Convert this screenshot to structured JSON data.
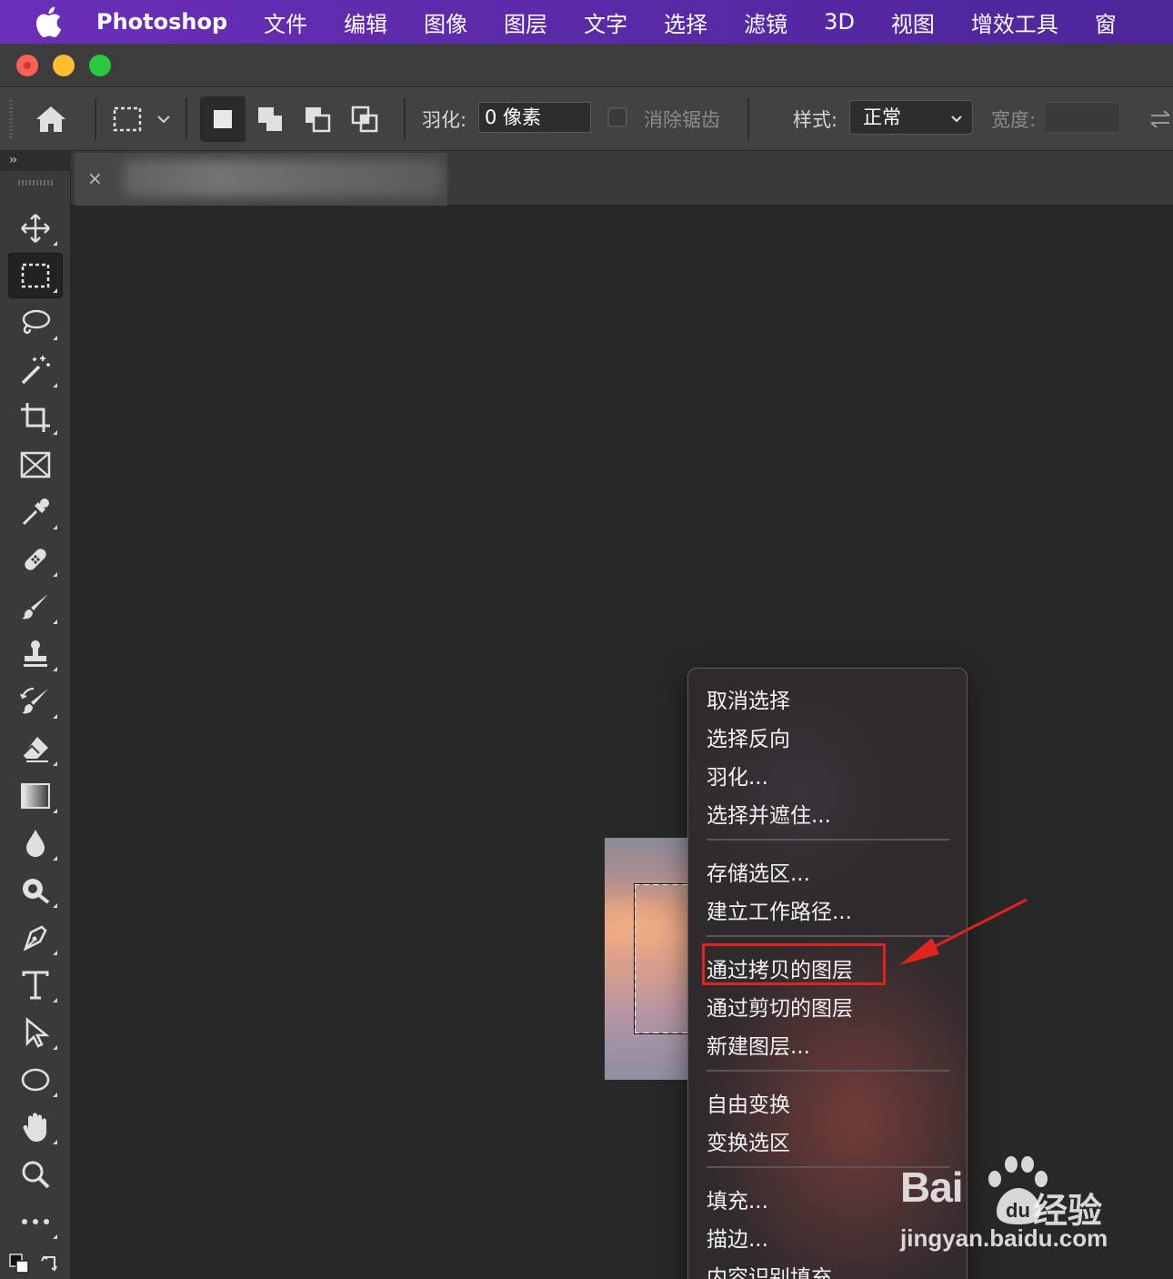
{
  "menubar": {
    "app": "Photoshop",
    "items": [
      "文件",
      "编辑",
      "图像",
      "图层",
      "文字",
      "选择",
      "滤镜",
      "3D",
      "视图",
      "增效工具",
      "窗"
    ]
  },
  "options": {
    "feather_label": "羽化:",
    "feather_value": "0 像素",
    "antialias_label": "消除锯齿",
    "style_label": "样式:",
    "style_value": "正常",
    "width_label": "宽度:"
  },
  "toolbar": {
    "collapse": "››",
    "tools": [
      "move-tool",
      "rectangular-marquee-tool",
      "lasso-tool",
      "magic-wand-tool",
      "crop-tool",
      "frame-tool",
      "eyedropper-tool",
      "healing-brush-tool",
      "brush-tool",
      "clone-stamp-tool",
      "history-brush-tool",
      "eraser-tool",
      "gradient-tool",
      "blur-tool",
      "dodge-tool",
      "pen-tool",
      "type-tool",
      "path-selection-tool",
      "ellipse-tool",
      "hand-tool",
      "zoom-tool",
      "more-tools"
    ]
  },
  "document": {
    "close": "×"
  },
  "context_menu": {
    "groups": [
      [
        "取消选择",
        "选择反向",
        "羽化...",
        "选择并遮住..."
      ],
      [
        "存储选区...",
        "建立工作路径..."
      ],
      [
        "通过拷贝的图层",
        "通过剪切的图层",
        "新建图层..."
      ],
      [
        "自由变换",
        "变换选区"
      ],
      [
        "填充...",
        "描边...",
        "内容识别填充..."
      ]
    ],
    "highlighted": "通过拷贝的图层",
    "highlight_color": "#e0231d"
  },
  "watermark": {
    "brand_latin": "Bai",
    "brand_cn": "经验",
    "url": "jingyan.baidu.com"
  },
  "colors": {
    "menubar": "#5a2aa8",
    "canvas": "#282828",
    "panel": "#3a3a3a",
    "annotation": "#e0231d"
  }
}
